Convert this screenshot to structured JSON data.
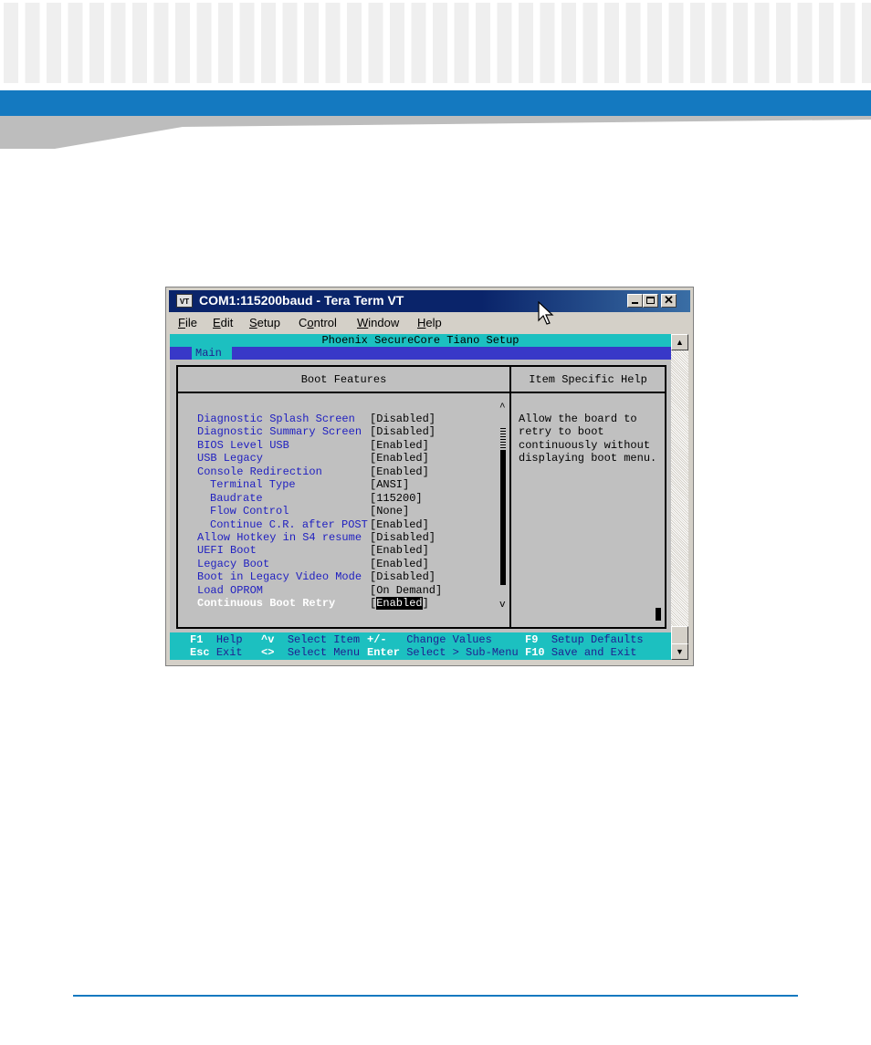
{
  "window": {
    "title": "COM1:115200baud - Tera Term VT",
    "icon_label": "VT",
    "menu": [
      "File",
      "Edit",
      "Setup",
      "Control",
      "Window",
      "Help"
    ],
    "menu_mnemonics": [
      "F",
      "E",
      "S",
      "o",
      "W",
      "H"
    ]
  },
  "bios": {
    "header": "Phoenix SecureCore Tiano Setup",
    "tab": "Main",
    "panel_title": "Boot Features",
    "help_title": "Item Specific Help",
    "items": [
      {
        "label": "Diagnostic Splash Screen",
        "value": "[Disabled]",
        "indent": 0
      },
      {
        "label": "Diagnostic Summary Screen",
        "value": "[Disabled]",
        "indent": 0
      },
      {
        "label": "BIOS Level USB",
        "value": "[Enabled]",
        "indent": 0
      },
      {
        "label": "USB Legacy",
        "value": "[Enabled]",
        "indent": 0
      },
      {
        "label": "Console Redirection",
        "value": "[Enabled]",
        "indent": 0
      },
      {
        "label": "Terminal Type",
        "value": "[ANSI]",
        "indent": 1
      },
      {
        "label": "Baudrate",
        "value": "[115200]",
        "indent": 1
      },
      {
        "label": "Flow Control",
        "value": "[None]",
        "indent": 1
      },
      {
        "label": "Continue C.R. after POST",
        "value": "[Enabled]",
        "indent": 1
      },
      {
        "label": "Allow Hotkey in S4 resume",
        "value": "[Disabled]",
        "indent": 0
      },
      {
        "label": "UEFI Boot",
        "value": "[Enabled]",
        "indent": 0
      },
      {
        "label": "Legacy Boot",
        "value": "[Enabled]",
        "indent": 0
      },
      {
        "label": "Boot in Legacy Video Mode",
        "value": "[Disabled]",
        "indent": 0
      },
      {
        "label": "Load OPROM",
        "value": "[On Demand]",
        "indent": 0
      }
    ],
    "selected": {
      "label": "Continuous Boot Retry",
      "value_open": "[",
      "value_highlight": "Enabled",
      "value_close": "]"
    },
    "help_lines": [
      "Allow the board to",
      "retry to boot",
      "continuously without",
      "displaying boot menu."
    ],
    "scroll_up": "^",
    "scroll_down": "v",
    "footer": [
      {
        "key": "F1",
        "desc": "Help"
      },
      {
        "key": "^v",
        "desc": "Select Item"
      },
      {
        "key": "+/-",
        "desc": "Change Values"
      },
      {
        "key": "F9",
        "desc": "Setup Defaults"
      },
      {
        "key": "Esc",
        "desc": "Exit"
      },
      {
        "key": "<>",
        "desc": "Select Menu"
      },
      {
        "key": "Enter",
        "desc": "Select > Sub-Menu"
      },
      {
        "key": "F10",
        "desc": "Save and Exit"
      }
    ]
  },
  "colors": {
    "brand_blue": "#1479c0",
    "title_bar": "#0a246a",
    "bios_cyan": "#1cc0c0",
    "bios_label": "#2020c0"
  },
  "icons": [
    "minimize-icon",
    "maximize-icon",
    "close-icon",
    "mouse-pointer-icon"
  ]
}
